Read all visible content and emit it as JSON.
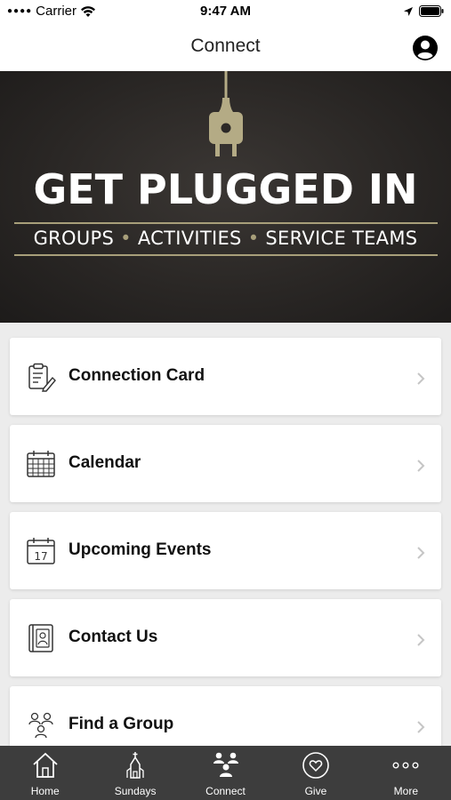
{
  "status_bar": {
    "carrier": "Carrier",
    "time": "9:47 AM"
  },
  "nav": {
    "title": "Connect"
  },
  "hero": {
    "title": "GET PLUGGED IN",
    "subtitle_items": [
      "GROUPS",
      "ACTIVITIES",
      "SERVICE TEAMS"
    ],
    "accent_color": "#a89f7a"
  },
  "menu": [
    {
      "label": "Connection Card",
      "icon": "clipboard-pencil-icon"
    },
    {
      "label": "Calendar",
      "icon": "calendar-grid-icon"
    },
    {
      "label": "Upcoming Events",
      "icon": "calendar-date-icon"
    },
    {
      "label": "Contact Us",
      "icon": "address-book-icon"
    },
    {
      "label": "Find a Group",
      "icon": "group-icon"
    }
  ],
  "calendar_day": "17",
  "tabs": [
    {
      "label": "Home",
      "icon": "home-icon"
    },
    {
      "label": "Sundays",
      "icon": "church-icon"
    },
    {
      "label": "Connect",
      "icon": "people-icon",
      "active": true
    },
    {
      "label": "Give",
      "icon": "heart-icon"
    },
    {
      "label": "More",
      "icon": "more-dots-icon"
    }
  ]
}
